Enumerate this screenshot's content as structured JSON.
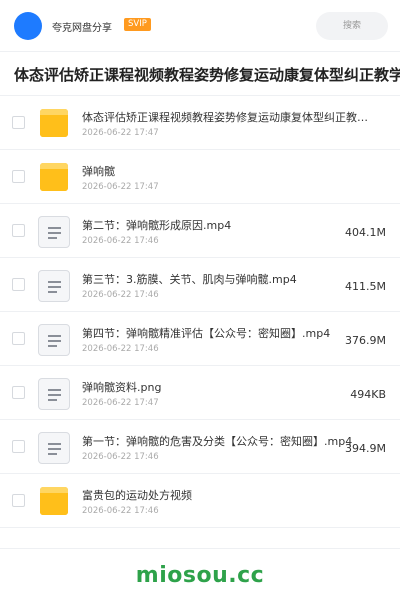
{
  "header": {
    "share_label": "夸克网盘分享",
    "badge": "SVIP",
    "search_placeholder": "搜索"
  },
  "page_title": "体态评估矫正课程视频教程姿势修复运动康复体型纠正教学",
  "files": [
    {
      "type": "folder",
      "name": "体态评估矫正课程视频教程姿势修复运动康复体型纠正教…",
      "date": "2026-06-22 17:47",
      "size": ""
    },
    {
      "type": "folder",
      "name": "弹响髋",
      "date": "2026-06-22 17:47",
      "size": ""
    },
    {
      "type": "file",
      "name": "第二节：弹响髋形成原因.mp4",
      "date": "2026-06-22 17:46",
      "size": "404.1M"
    },
    {
      "type": "file",
      "name": "第三节：3.筋膜、关节、肌肉与弹响髋.mp4",
      "date": "2026-06-22 17:46",
      "size": "411.5M"
    },
    {
      "type": "file",
      "name": "第四节：弹响髋精准评估【公众号：密知圈】.mp4",
      "date": "2026-06-22 17:46",
      "size": "376.9M"
    },
    {
      "type": "file",
      "name": "弹响髋资料.png",
      "date": "2026-06-22 17:47",
      "size": "494KB"
    },
    {
      "type": "file",
      "name": "第一节：弹响髋的危害及分类【公众号：密知圈】.mp4",
      "date": "2026-06-22 17:46",
      "size": "394.9M"
    },
    {
      "type": "folder",
      "name": "富贵包的运动处方视频",
      "date": "2026-06-22 17:46",
      "size": ""
    }
  ],
  "watermark": "miosou.cc",
  "colors": {
    "accent": "#1e7bff",
    "svip": "#ff9a1f",
    "folder": "#ffc42e",
    "watermark": "#2ea24a"
  }
}
